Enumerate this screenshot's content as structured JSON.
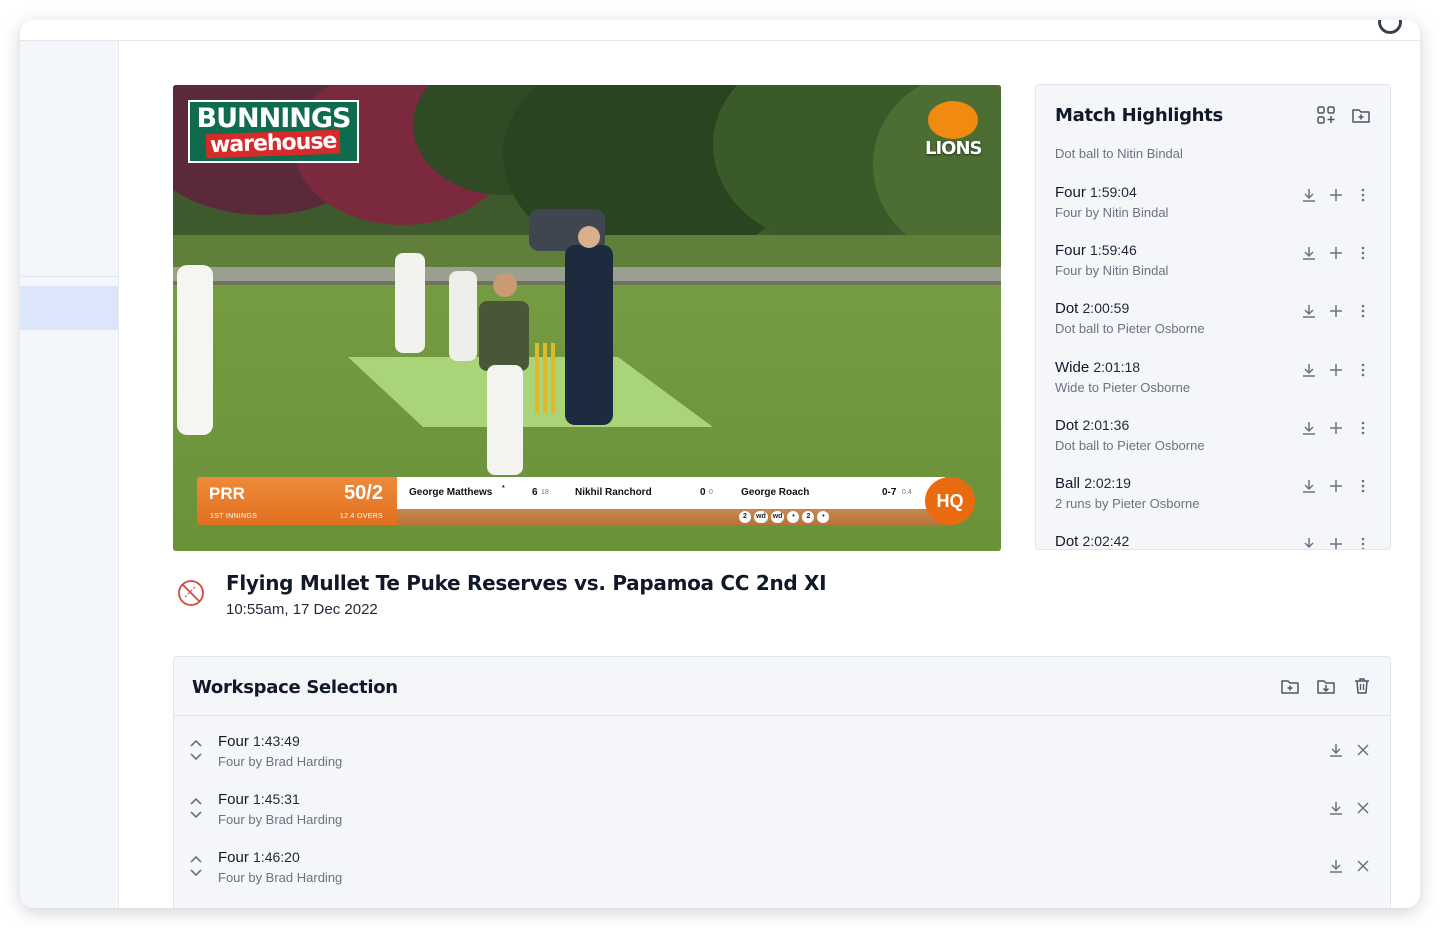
{
  "match": {
    "title": "Flying Mullet Te Puke Reserves vs. Papamoa CC 2nd XI",
    "date": "10:55am, 17 Dec 2022"
  },
  "video": {
    "sponsor_top": "BUNNINGS",
    "sponsor_bottom": "warehouse",
    "club_logo_text": "LIONS",
    "scoreboard": {
      "team": "PRR",
      "score": "50/2",
      "innings": "1ST INNINGS",
      "overs": "12.4 OVERS",
      "batter1_name": "George Matthews",
      "batter1_star": "*",
      "batter1_runs": "6",
      "batter1_balls": "18",
      "batter2_name": "Nikhil Ranchord",
      "batter2_runs": "0",
      "batter2_balls": "0",
      "bowler_name": "George Roach",
      "bowler_figures": "0-7",
      "bowler_overs": "0.4",
      "this_over": [
        "2",
        "wd",
        "wd",
        "•",
        "2",
        "•"
      ],
      "badge": "HQ"
    }
  },
  "highlights": {
    "title": "Match Highlights",
    "items": [
      {
        "type": "",
        "time": "",
        "desc": "Dot ball to Nitin Bindal"
      },
      {
        "type": "Four",
        "time": "1:59:04",
        "desc": "Four by Nitin Bindal"
      },
      {
        "type": "Four",
        "time": "1:59:46",
        "desc": "Four by Nitin Bindal"
      },
      {
        "type": "Dot",
        "time": "2:00:59",
        "desc": "Dot ball to Pieter Osborne"
      },
      {
        "type": "Wide",
        "time": "2:01:18",
        "desc": "Wide to Pieter Osborne"
      },
      {
        "type": "Dot",
        "time": "2:01:36",
        "desc": "Dot ball to Pieter Osborne"
      },
      {
        "type": "Ball",
        "time": "2:02:19",
        "desc": "2 runs by Pieter Osborne"
      },
      {
        "type": "Dot",
        "time": "2:02:42",
        "desc": ""
      }
    ]
  },
  "workspace": {
    "title": "Workspace Selection",
    "items": [
      {
        "type": "Four",
        "time": "1:43:49",
        "desc": "Four by Brad Harding"
      },
      {
        "type": "Four",
        "time": "1:45:31",
        "desc": "Four by Brad Harding"
      },
      {
        "type": "Four",
        "time": "1:46:20",
        "desc": "Four by Brad Harding"
      }
    ]
  },
  "icons": {
    "grid_add": "grid-add-icon",
    "folder_add": "folder-add-icon",
    "folder_download": "folder-download-icon",
    "trash": "trash-icon",
    "download": "download-icon",
    "plus": "plus-icon",
    "more": "more-vertical-icon",
    "close": "close-icon",
    "reorder": "reorder-icon",
    "no_ball": "cricket-ball-slash-icon"
  },
  "colors": {
    "accent_orange": "#e1701f",
    "panel_bg": "#f4f6fa",
    "sidebar_active": "#dbe6fb"
  }
}
